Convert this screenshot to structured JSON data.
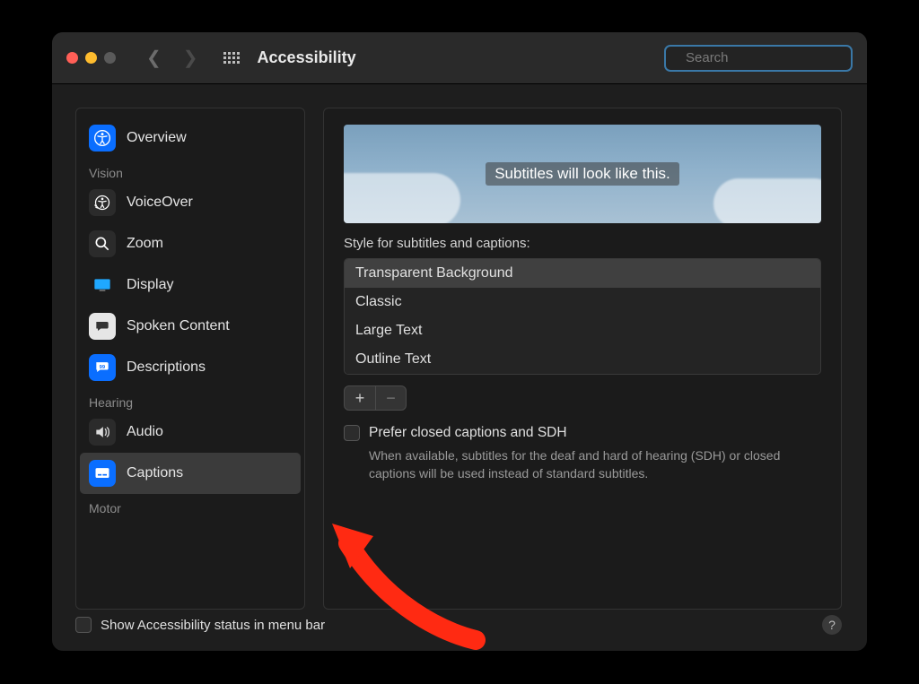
{
  "titlebar": {
    "title": "Accessibility",
    "search_placeholder": "Search"
  },
  "sidebar": {
    "items": [
      {
        "section": null,
        "label": "Overview"
      },
      {
        "section": "Vision"
      },
      {
        "section": null,
        "label": "VoiceOver"
      },
      {
        "section": null,
        "label": "Zoom"
      },
      {
        "section": null,
        "label": "Display"
      },
      {
        "section": null,
        "label": "Spoken Content"
      },
      {
        "section": null,
        "label": "Descriptions"
      },
      {
        "section": "Hearing"
      },
      {
        "section": null,
        "label": "Audio"
      },
      {
        "section": null,
        "label": "Captions",
        "selected": true
      },
      {
        "section": "Motor"
      }
    ]
  },
  "main": {
    "preview_caption": "Subtitles will look like this.",
    "style_label": "Style for subtitles and captions:",
    "styles": [
      {
        "label": "Transparent Background",
        "selected": true
      },
      {
        "label": "Classic"
      },
      {
        "label": "Large Text"
      },
      {
        "label": "Outline Text"
      }
    ],
    "prefer_sdh_label": "Prefer closed captions and SDH",
    "prefer_sdh_help": "When available, subtitles for the deaf and hard of hearing (SDH) or closed captions will be used instead of standard subtitles."
  },
  "footer": {
    "menubar_label": "Show Accessibility status in menu bar"
  }
}
